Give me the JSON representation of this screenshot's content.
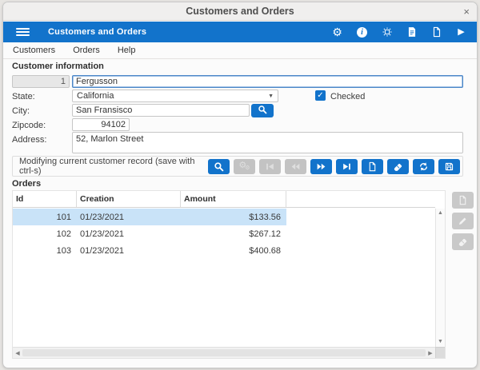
{
  "window": {
    "title": "Customers and Orders",
    "close_glyph": "×"
  },
  "appbar": {
    "title": "Customers and Orders",
    "icons": [
      {
        "name": "settings-gear-icon",
        "icon": "gear"
      },
      {
        "name": "info-icon",
        "icon": "info"
      },
      {
        "name": "preferences-chip-icon",
        "icon": "chip"
      },
      {
        "name": "report-file-icon",
        "icon": "file-lines"
      },
      {
        "name": "blank-file-icon",
        "icon": "file-blank"
      },
      {
        "name": "run-play-icon",
        "icon": "play"
      }
    ]
  },
  "menubar": {
    "items": [
      "Customers",
      "Orders",
      "Help"
    ]
  },
  "customer": {
    "section_title": "Customer information",
    "id_value": "1",
    "name_value": "Fergusson",
    "state_label": "State:",
    "state_value": "California",
    "checked_label": "Checked",
    "city_label": "City:",
    "city_value": "San Fransisco",
    "zip_label": "Zipcode:",
    "zip_value": "94102",
    "address_label": "Address:",
    "address_value": "52, Marlon Street"
  },
  "statusbar": {
    "message": "Modifying current customer record (save with ctrl-s)",
    "buttons": [
      {
        "name": "search-record-button",
        "icon": "search",
        "enabled": true
      },
      {
        "name": "actions-cogs-button",
        "icon": "cogs",
        "enabled": false
      },
      {
        "name": "first-record-button",
        "icon": "skip-start",
        "enabled": false
      },
      {
        "name": "previous-record-button",
        "icon": "rewind",
        "enabled": false
      },
      {
        "name": "next-record-button",
        "icon": "fast-forward",
        "enabled": true
      },
      {
        "name": "last-record-button",
        "icon": "skip-end",
        "enabled": true
      },
      {
        "name": "new-record-button",
        "icon": "file-blank",
        "enabled": true
      },
      {
        "name": "erase-record-button",
        "icon": "eraser",
        "enabled": true
      },
      {
        "name": "refresh-button",
        "icon": "refresh",
        "enabled": true
      },
      {
        "name": "save-button",
        "icon": "save",
        "enabled": true
      }
    ]
  },
  "orders": {
    "section_title": "Orders",
    "table": {
      "columns": [
        "Id",
        "Creation",
        "Amount"
      ],
      "rows": [
        {
          "id": "101",
          "creation": "01/23/2021",
          "amount": "$133.56",
          "selected": true
        },
        {
          "id": "102",
          "creation": "01/23/2021",
          "amount": "$267.12",
          "selected": false
        },
        {
          "id": "103",
          "creation": "01/23/2021",
          "amount": "$400.68",
          "selected": false
        }
      ]
    },
    "side_buttons": [
      {
        "name": "new-order-button",
        "icon": "file-blank",
        "enabled": false
      },
      {
        "name": "edit-order-button",
        "icon": "pencil",
        "enabled": false
      },
      {
        "name": "delete-order-button",
        "icon": "eraser",
        "enabled": false
      }
    ]
  },
  "colors": {
    "accent_blue": "#1273cb",
    "selected_row": "#c9e3f8",
    "disabled_gray": "#c3c3c3",
    "titlebar_bg": "#f0efee"
  }
}
